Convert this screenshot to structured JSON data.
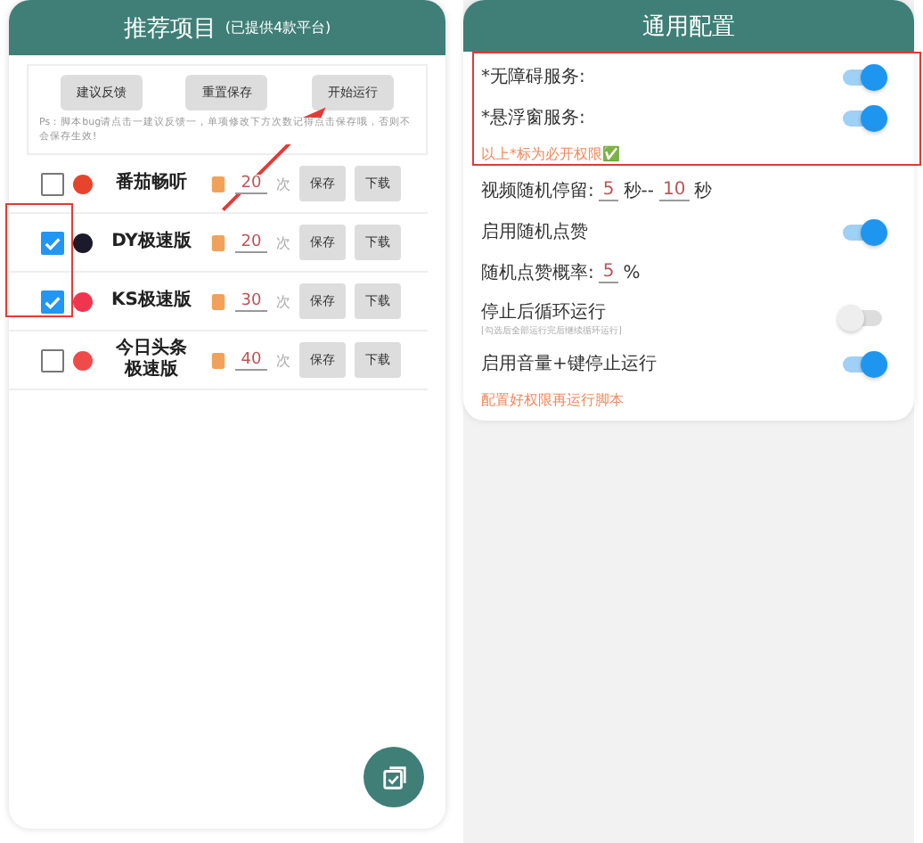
{
  "left": {
    "title": "推荐项目",
    "subtitle": "(已提供4款平台)",
    "actions": [
      {
        "label": "建议反馈"
      },
      {
        "label": "重置保存"
      },
      {
        "label": "开始运行"
      }
    ],
    "hint": "Ps：脚本bug请点击一建议反馈一，单项修改下方次数记得点击保存哦，否则不会保存生效!",
    "apps": [
      {
        "name": "番茄畅听",
        "checked": false,
        "color": "#e8432c",
        "count": "20",
        "unit": "次",
        "save": "保存",
        "download": "下载"
      },
      {
        "name": "DY极速版",
        "checked": true,
        "color": "#1a1a2a",
        "count": "20",
        "unit": "次",
        "save": "保存",
        "download": "下载"
      },
      {
        "name": "KS极速版",
        "checked": true,
        "color": "#f0364f",
        "count": "30",
        "unit": "次",
        "save": "保存",
        "download": "下载"
      },
      {
        "name": "今日头条极速版",
        "checked": false,
        "color": "#f04a4a",
        "count": "40",
        "unit": "次",
        "save": "保存",
        "download": "下载"
      }
    ]
  },
  "right": {
    "title": "通用配置",
    "settings": [
      {
        "kind": "toggle",
        "label": "*无障碍服务:",
        "on": true
      },
      {
        "kind": "toggle",
        "label": "*悬浮窗服务:",
        "on": true
      },
      {
        "kind": "note",
        "text": "以上*标为必开权限✅"
      },
      {
        "kind": "range",
        "label": "视频随机停留:",
        "from": "5",
        "mid": "秒--",
        "to": "10",
        "unit": "秒"
      },
      {
        "kind": "toggle",
        "label": "启用随机点赞",
        "on": true
      },
      {
        "kind": "percent",
        "label": "随机点赞概率:",
        "value": "5",
        "unit": "%"
      },
      {
        "kind": "toggle",
        "label": "停止后循环运行",
        "on": false,
        "sub": "[勾选后全部运行完后继续循环运行]"
      },
      {
        "kind": "toggle",
        "label": "启用音量+键停止运行",
        "on": true
      },
      {
        "kind": "note",
        "text": "配置好权限再运行脚本"
      }
    ]
  }
}
